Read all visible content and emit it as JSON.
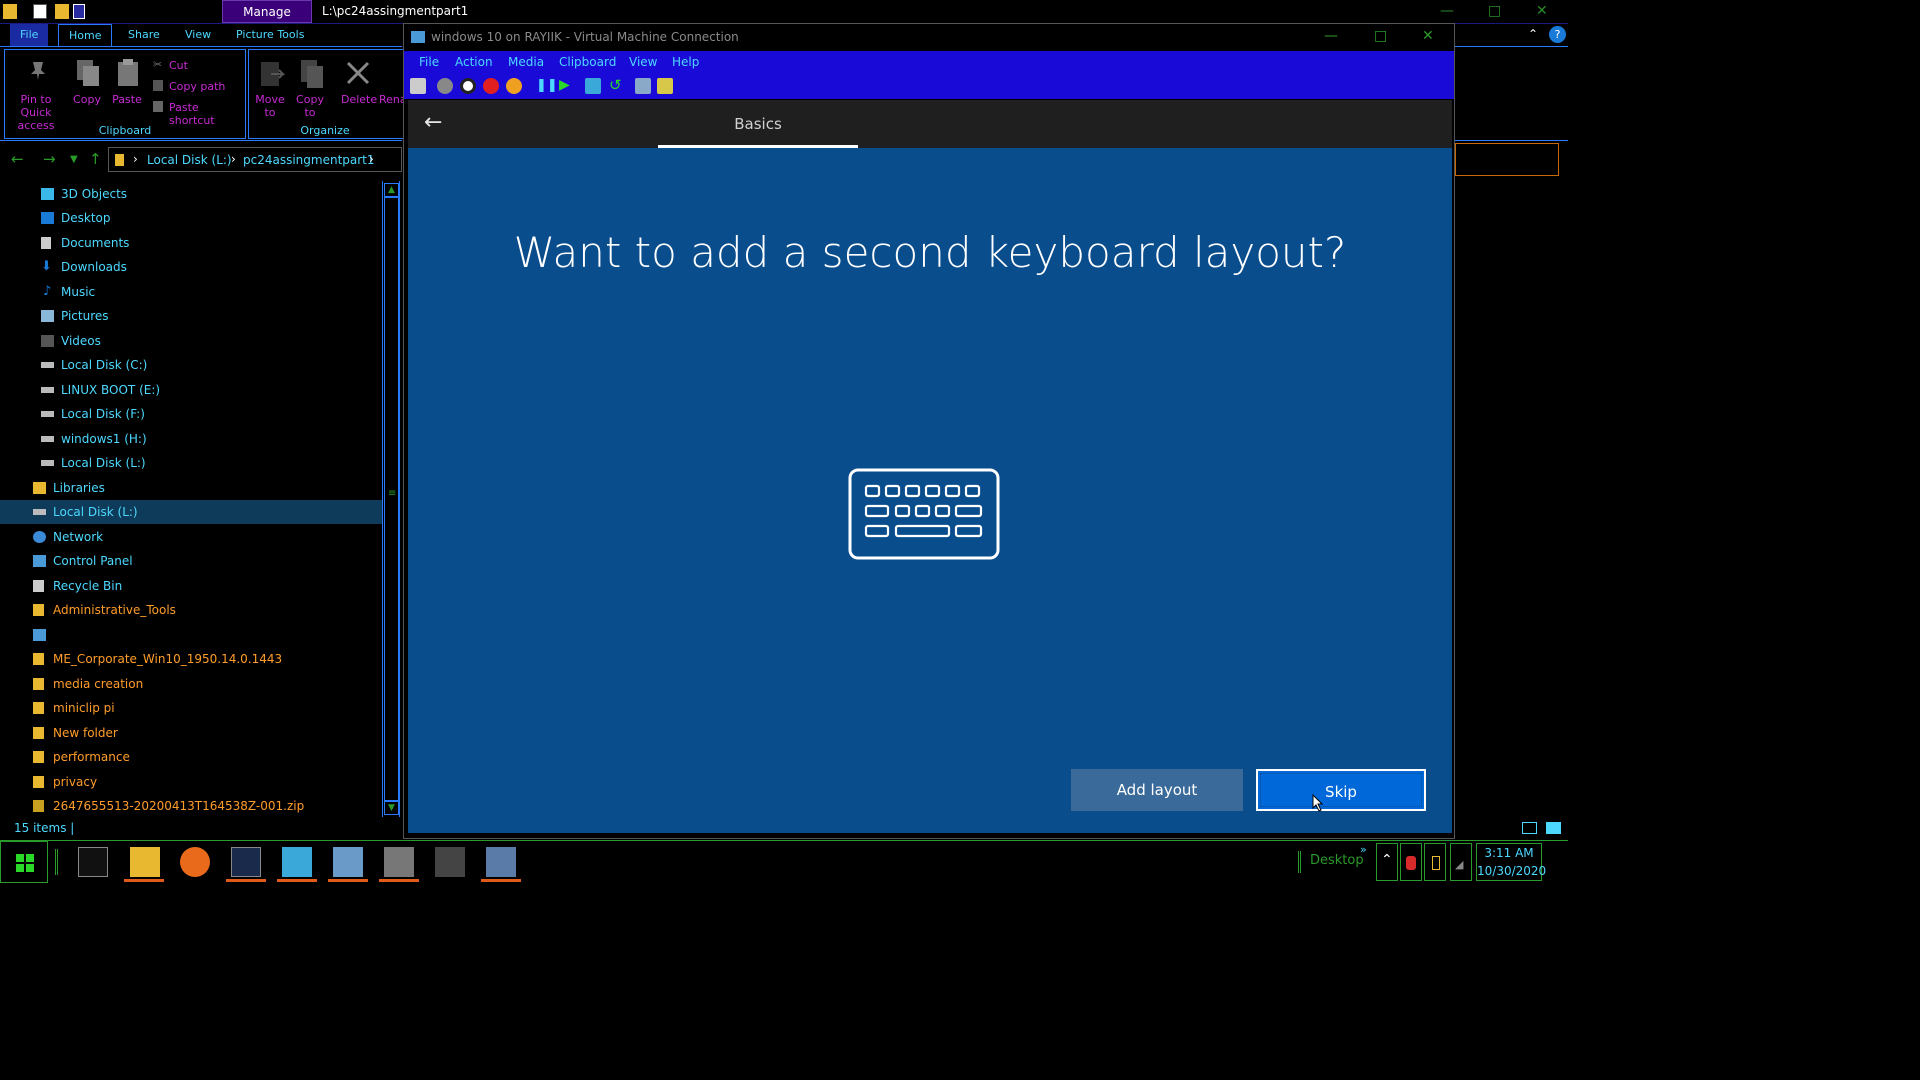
{
  "explorer": {
    "quick_access": [
      "folder-icon",
      "properties-icon",
      "new-folder-icon",
      "customize-icon"
    ],
    "manage_tab": "Manage",
    "window_title": "L:\\pc24assingmentpart1",
    "ribbon_tabs": [
      "File",
      "Home",
      "Share",
      "View",
      "Picture Tools"
    ],
    "ribbon": {
      "clipboard_group": "Clipboard",
      "organize_group": "Organize",
      "pin_label_1": "Pin to Quick",
      "pin_label_2": "access",
      "copy": "Copy",
      "paste": "Paste",
      "cut": "Cut",
      "copy_path": "Copy path",
      "paste_shortcut": "Paste shortcut",
      "move_1": "Move",
      "move_2": "to",
      "copy_to_1": "Copy",
      "copy_to_2": "to",
      "delete": "Delete",
      "rename": "Rena"
    },
    "breadcrumb": [
      "Local Disk (L:)",
      "pc24assingmentpart1"
    ],
    "nav_items": [
      {
        "label": "3D Objects",
        "icon": "3d-objects-icon"
      },
      {
        "label": "Desktop",
        "icon": "desktop-icon"
      },
      {
        "label": "Documents",
        "icon": "documents-icon"
      },
      {
        "label": "Downloads",
        "icon": "downloads-icon"
      },
      {
        "label": "Music",
        "icon": "music-icon"
      },
      {
        "label": "Pictures",
        "icon": "pictures-icon"
      },
      {
        "label": "Videos",
        "icon": "videos-icon"
      },
      {
        "label": "Local Disk (C:)",
        "icon": "drive-icon"
      },
      {
        "label": "LINUX BOOT (E:)",
        "icon": "drive-icon"
      },
      {
        "label": "Local Disk (F:)",
        "icon": "drive-icon"
      },
      {
        "label": "windows1 (H:)",
        "icon": "drive-icon"
      },
      {
        "label": "Local Disk (L:)",
        "icon": "drive-icon"
      },
      {
        "label": "Libraries",
        "icon": "libraries-icon"
      },
      {
        "label": "Local Disk (L:)",
        "icon": "drive-icon"
      },
      {
        "label": "Network",
        "icon": "network-icon"
      },
      {
        "label": "Control Panel",
        "icon": "control-panel-icon"
      },
      {
        "label": "Recycle Bin",
        "icon": "recycle-bin-icon"
      },
      {
        "label": "Administrative_Tools",
        "icon": "folder-icon"
      },
      {
        "label": "",
        "icon": "control-panel-icon"
      },
      {
        "label": "ME_Corporate_Win10_1950.14.0.1443",
        "icon": "folder-icon"
      },
      {
        "label": "media creation",
        "icon": "folder-icon"
      },
      {
        "label": "miniclip pi",
        "icon": "folder-icon"
      },
      {
        "label": "New folder",
        "icon": "folder-icon"
      },
      {
        "label": "performance",
        "icon": "folder-icon"
      },
      {
        "label": "privacy",
        "icon": "folder-icon"
      },
      {
        "label": "2647655513-20200413T164538Z-001.zip",
        "icon": "zip-icon"
      }
    ],
    "status": "15 items"
  },
  "vm": {
    "title": "windows 10 on RAYIIK - Virtual Machine Connection",
    "menu": [
      "File",
      "Action",
      "Media",
      "Clipboard",
      "View",
      "Help"
    ],
    "toolbar": [
      "ctrl-alt-del-icon",
      "start-icon",
      "turn-off-icon",
      "shutdown-icon",
      "save-icon",
      "pause-icon",
      "resume-icon",
      "checkpoint-icon",
      "revert-icon",
      "enhanced-session-icon",
      "share-icon"
    ]
  },
  "oobe": {
    "tab": "Basics",
    "heading": "Want to add a second keyboard layout?",
    "add_layout": "Add layout",
    "skip": "Skip"
  },
  "taskbar": {
    "apps": [
      "terminal-icon",
      "file-explorer-icon",
      "firefox-icon",
      "powershell-icon",
      "building-icon",
      "network-app-icon",
      "server-icon",
      "notes-icon",
      "hyperv-icon"
    ],
    "desktop": "Desktop",
    "time": "3:11 AM",
    "date": "10/30/2020"
  },
  "colors": {
    "oobe_background": "#0a4d8c",
    "vm_menubar": "#1a0ad8",
    "explorer_accent": "#4dd9ff",
    "folder_label": "#ff9d2a",
    "skip_button": "#0068d8"
  }
}
